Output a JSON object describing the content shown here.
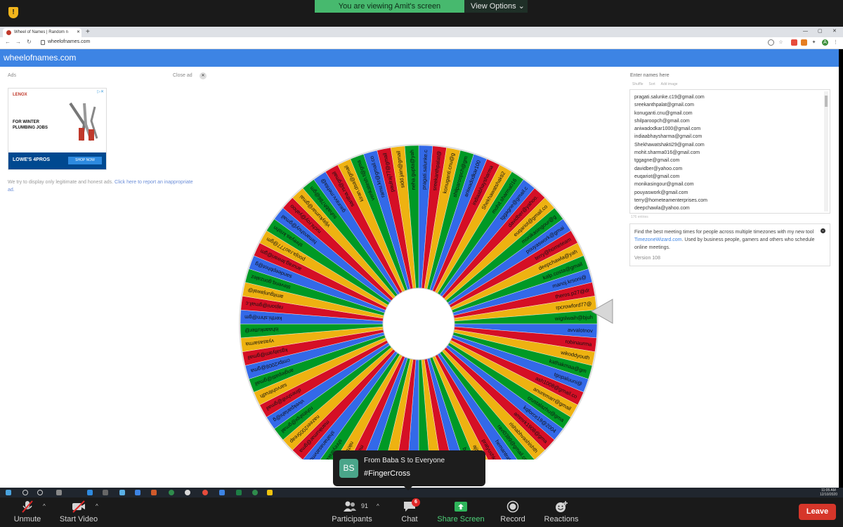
{
  "zoom_top": {
    "viewing_text": "You are viewing Amit's screen",
    "view_options": "View Options ⌄",
    "shield_glyph": "!"
  },
  "browser": {
    "tab_title": "Wheel of Names | Random n",
    "tab_close": "✕",
    "new_tab": "+",
    "url": "wheelofnames.com",
    "back": "←",
    "forward": "→",
    "reload": "↻",
    "minimize": "—",
    "maximize": "▢",
    "close": "✕"
  },
  "site": {
    "header": "wheelofnames.com",
    "ads_label": "Ads",
    "close_ad": "Close ad",
    "close_ad_icon": "✕",
    "ad": {
      "brand": "LENOX",
      "headline": "FOR WINTER PLUMBING JOBS",
      "footer_brand": "LOWE'S 4PROS",
      "cta": "SHOP NOW",
      "adchoices": "▷✕"
    },
    "ad_note_prefix": "We try to display only legitimate and honest ads. ",
    "ad_note_link": "Click here to report an inappropriate ad.",
    "entries_label": "Enter names here",
    "tools": [
      "Shuffle",
      "Sort",
      "Add image"
    ],
    "entries": [
      "pragati.salunke.c19@gmail.com",
      "sreekanthpalat@gmail.com",
      "konuganti.cnu@gmail.com",
      "shilparoopch@gmail.com",
      "aniwadodkar1000@gmail.com",
      "indiaabhaysharma@gmail.com",
      "Shekhawatshakti29@gmail.com",
      "mohit.sharma016@gmail.com",
      "tggagne@gmail.com",
      "davidber@yahoo.com",
      "euqariot@gmail.com",
      "monikasingour@gmail.com",
      "pouyaswork@gmail.com",
      "terry@hometeamenterprises.com",
      "deepchawla@yahoo.com"
    ],
    "entries_count": "176 entries",
    "promo_prefix": "Find the best meeting times for people across multiple timezones with my new tool ",
    "promo_link": "TimezoneWizard.com",
    "promo_suffix": ". Used by business people, gamers and others who schedule online meetings.",
    "promo_toggle": "⌄",
    "version": "Version 108"
  },
  "wheel": {
    "slice_colors": [
      "#3369e8",
      "#d50f25",
      "#eeb211",
      "#009925"
    ],
    "pointer_color": "#d7d7d7",
    "labels": [
      "pragati.salunke.c",
      "sreekanthpalat@",
      "konuganti.cnu@g",
      "shilparoopch@gm",
      "aniwadodkar100",
      "indiaabhaysharma",
      "Shekhawatshakti2",
      "mohit.sharma016",
      "tggagne@gmail.c",
      "davidber@yahoo.",
      "euqariot@gmail.co",
      "monikasingour@g",
      "pouyaswork@gmai",
      "terry@hometeam",
      "deepchawla@yah",
      "kalp.costa@gmail",
      "manoj.krsoni@",
      "theros.p27@dr",
      "rpcrowford77@",
      "wigslwaih@bjuh",
      "avvalotnov",
      "robinaurma",
      "wikoddyouth",
      "kathakmaa@gm",
      "tgopaluuni@",
      "ash1008@gmail.co",
      "anuremarr@gmail",
      "crustalazhu@gma",
      "kqforce19@2004",
      "ammrk1908@gma",
      "rishabhvashishth",
      "ravi0389@gmail.co",
      "hemantrathore",
      "pratyushkumar.22",
      "ajit.singh2909@g",
      "brandonvangalder",
      "zoha25@aol.com",
      "lokendrasharma9",
      "ichouenqvs@gm",
      "ai.thomas@yahoo",
      "sarvesh.hps@gm",
      "nandiniajay@gma",
      "joyashu@gmail.c",
      "alijambilig@gm",
      "satyanarayan",
      "manjuhumar30@",
      "nikhilnoya@gma",
      "shreyaniketk@",
      "shahanasatvmu",
      "manikumar@gma",
      "nazeer2005reap",
      "rohitsihpi@gmail",
      "vivekparlahi@g",
      "dineshn8@gmail",
      "sarvohitrudh",
      "angiepatti@gmail",
      "cmtpr2008@gma",
      "kgsatyam@gmail",
      "vyasasarma",
      "ishaankutter@",
      "kerthi.shrn@gm",
      "rajsoni@gmail.c",
      "amitgunjawal@",
      "stevenq.gonzalez",
      "sandeepbhot@g",
      "anurag.tewari@gm",
      "pooja.rao777@gm",
      "shreyas.krishn",
      "himanshuy@gmail",
      "ruchi.roy@yahoo",
      "vijaykumar@gmai",
      "suhaibh786@gm",
      "gauravv.mehta@",
      "saritha.rs@gmail",
      "kiran.dsa@gmail",
      "venkatesh.t@gma",
      "ramu.kr@gmail.co",
      "paulraj77@gmail",
      "sidd.jain@gmail",
      "neha.gupta@yah"
    ]
  },
  "taskbar": {
    "time": "11:05 AM",
    "date": "12/10/2020"
  },
  "zoom_bar": {
    "unmute": "Unmute",
    "start_video": "Start Video",
    "participants": "Participants",
    "participants_count": "91",
    "chat": "Chat",
    "chat_badge": "6",
    "share_screen": "Share Screen",
    "record": "Record",
    "reactions": "Reactions",
    "leave": "Leave",
    "caret": "^"
  },
  "chat_popup": {
    "avatar": "BS",
    "from": "From Baba S to Everyone",
    "message": "#FingerCross"
  }
}
